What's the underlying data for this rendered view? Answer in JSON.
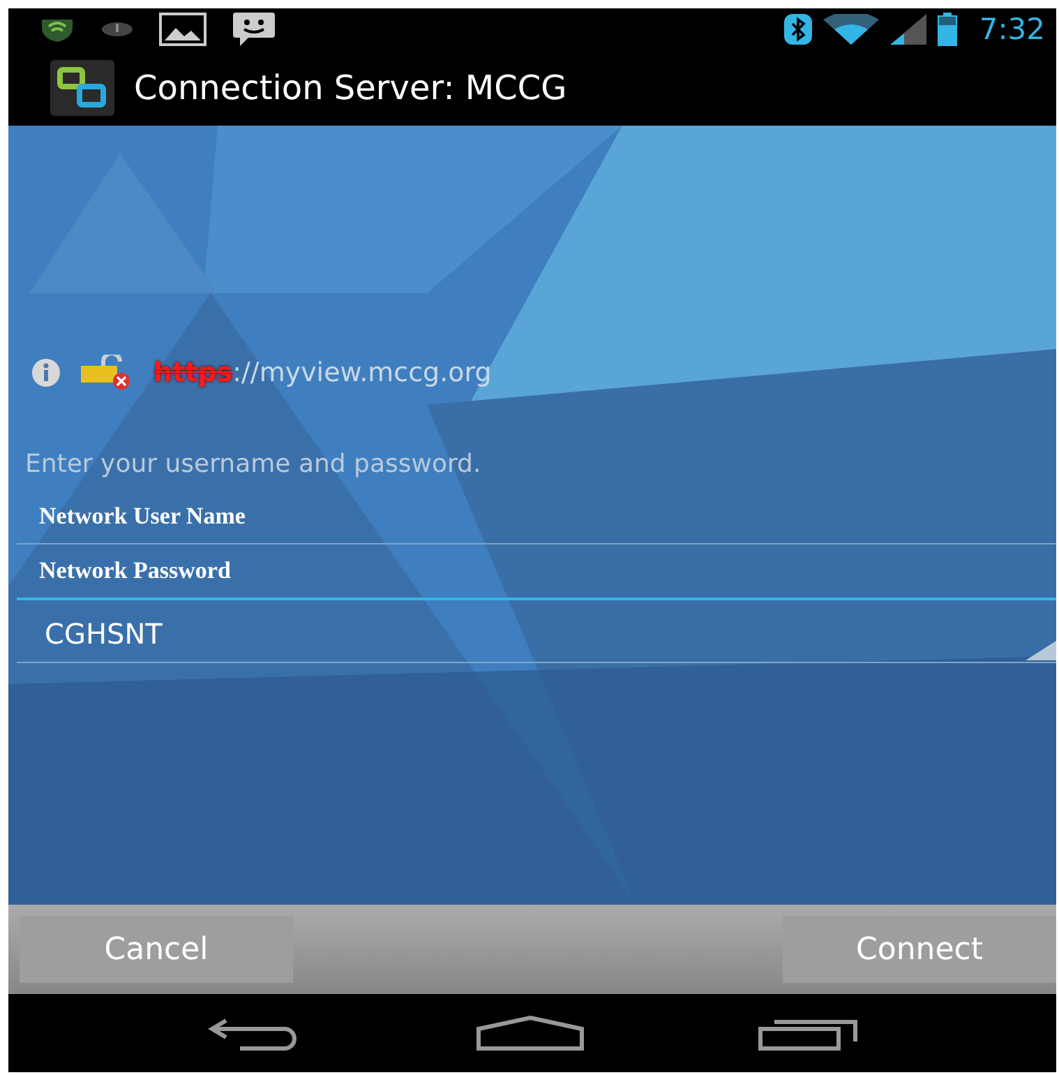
{
  "status_bar": {
    "time": "7:32"
  },
  "action_bar": {
    "title": "Connection Server: MCCG"
  },
  "server": {
    "scheme": "https",
    "rest": "://myview.mccg.org",
    "insecure": true
  },
  "prompt": "Enter your username and password.",
  "fields": [
    {
      "value": "Network User Name",
      "focused": false
    },
    {
      "value": "Network  Password",
      "focused": true
    }
  ],
  "domain": {
    "value": "CGHSNT"
  },
  "buttons": [
    "Cancel",
    "Connect"
  ]
}
